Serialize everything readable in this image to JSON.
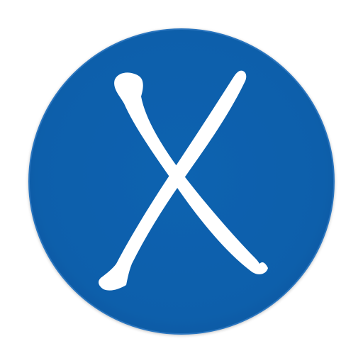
{
  "app_icon": {
    "icon_name": "letter-x-logo-icon",
    "glyph": "X",
    "colors": {
      "circle_fill": "#0F5FAB",
      "circle_edge": "#2B75BE",
      "glyph_fill": "#FFFFFF",
      "background": "#FFFFFF"
    }
  }
}
